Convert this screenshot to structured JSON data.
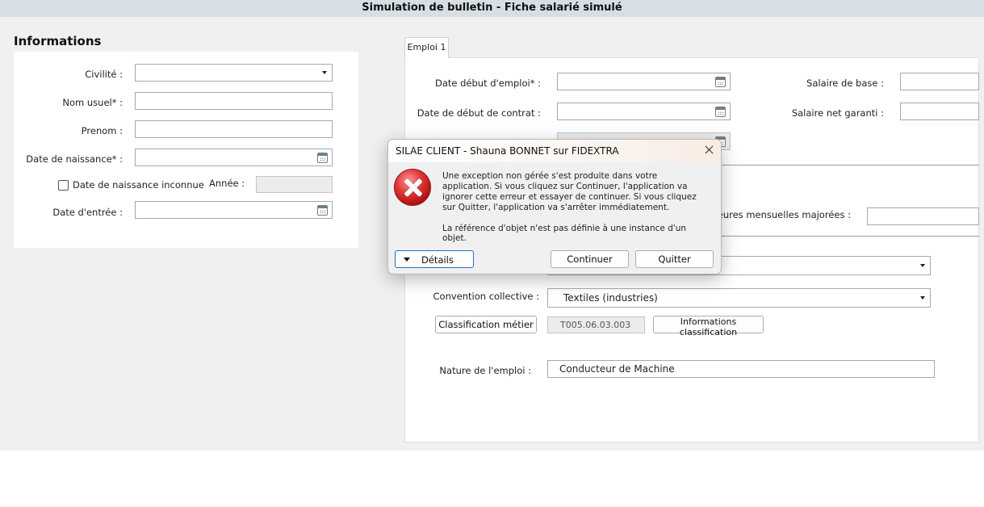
{
  "window": {
    "title": "Simulation de bulletin - Fiche salarié simulé"
  },
  "informations": {
    "heading": "Informations",
    "civilite_label": "Civilité :",
    "nom_usuel_label": "Nom usuel* :",
    "prenom_label": "Prenom :",
    "date_naissance_label": "Date de naissance* :",
    "date_naissance_inconnue_label": "Date de naissance inconnue",
    "annee_label": "Année :",
    "date_entree_label": "Date d'entrée :"
  },
  "emploi": {
    "tab_label": "Emploi 1",
    "date_debut_emploi_label": "Date début d'emploi* :",
    "date_debut_contrat_label": "Date de début de contrat :",
    "salaire_base_label": "Salaire de base :",
    "salaire_net_label": "Salaire net garanti :",
    "heures_majorees_label": "Heures mensuelles majorées :",
    "convention_label": "Convention collective :",
    "convention_value": "Textiles (industries)",
    "classification_button": "Classification métier",
    "classification_code": "T005.06.03.003",
    "informations_classification_button": "Informations classification",
    "nature_label": "Nature de l'emploi :",
    "nature_value": "Conducteur de Machine"
  },
  "dialog": {
    "title": "SILAE CLIENT - Shauna BONNET sur FIDEXTRA",
    "message": "Une exception non gérée s'est produite dans votre application. Si vous cliquez sur Continuer, l'application va ignorer cette erreur et essayer de continuer. Si vous cliquez sur Quitter, l'application va s'arrêter immédiatement.",
    "reference": "La référence d'objet n'est pas définie à une instance d'un objet.",
    "details_button": "Détails",
    "continue_button": "Continuer",
    "quit_button": "Quitter",
    "icon": "error-icon"
  }
}
